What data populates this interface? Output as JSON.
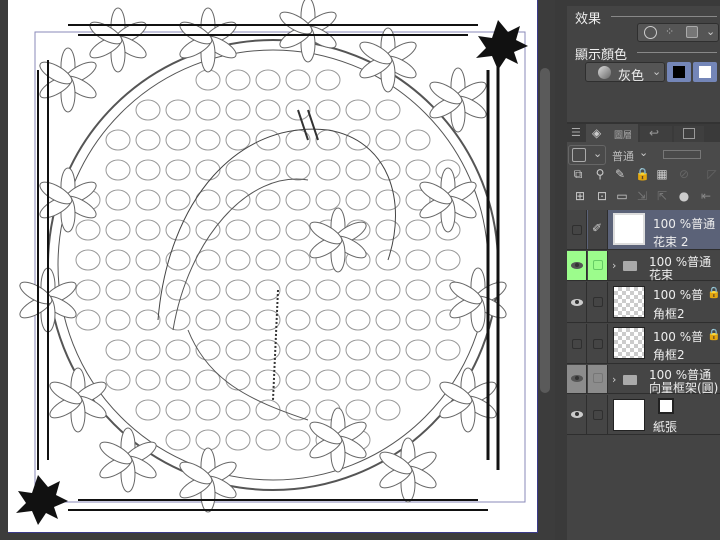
{
  "properties": {
    "effect_label": "效果",
    "display_color_label": "顯示顏色",
    "display_color_value": "灰色",
    "colors": {
      "main": "#000000",
      "sub": "#ffffff",
      "accent": "#7486b8"
    }
  },
  "layer_panel": {
    "tab_label": "圖層",
    "blend_mode": "普通",
    "layers": [
      {
        "name": "花束 2",
        "info": "100 %普通",
        "visible": false,
        "selected": true,
        "type": "raster",
        "editing": true
      },
      {
        "name": "花束",
        "info": "100 %普通",
        "visible": true,
        "type": "folder",
        "highlight": "#9cfc8c"
      },
      {
        "name": "角框2",
        "info": "100 %普",
        "visible": true,
        "type": "raster",
        "locked": true
      },
      {
        "name": "角框2",
        "info": "100 %普",
        "visible": false,
        "type": "raster",
        "locked": true
      },
      {
        "name": "向量框架(圓)",
        "info": "100 %普通",
        "visible": true,
        "type": "folder"
      },
      {
        "name": "紙張",
        "info": "",
        "visible": true,
        "type": "paper"
      }
    ]
  }
}
